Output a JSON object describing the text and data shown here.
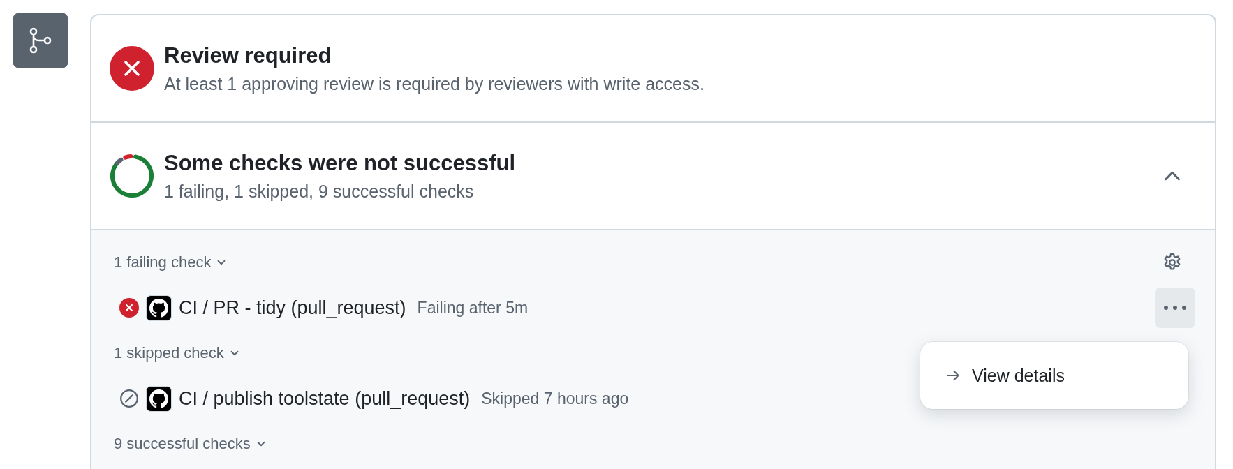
{
  "review": {
    "kind": "failure",
    "title": "Review required",
    "subtitle": "At least 1 approving review is required by reviewers with write access."
  },
  "checks": {
    "title": "Some checks were not successful",
    "summary": "1 failing, 1 skipped, 9 successful checks",
    "expanded": true,
    "groups": [
      {
        "label": "1 failing check",
        "checks": [
          {
            "kind": "failure",
            "name": "CI / PR - tidy (pull_request)",
            "detail": "Failing after 5m"
          }
        ]
      },
      {
        "label": "1 skipped check",
        "checks": [
          {
            "kind": "skipped",
            "name": "CI / publish toolstate (pull_request)",
            "detail": "Skipped 7 hours ago"
          }
        ]
      },
      {
        "label": "9 successful checks"
      }
    ]
  },
  "menu": {
    "open": true,
    "items": [
      {
        "label": "View details"
      }
    ]
  }
}
